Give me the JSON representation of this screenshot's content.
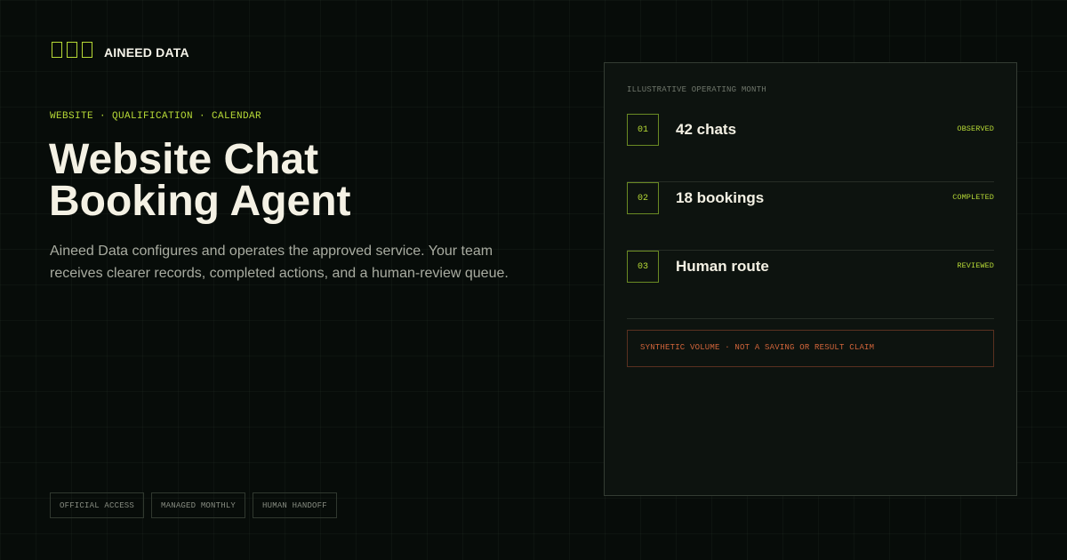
{
  "brand": {
    "name": "AINEED DATA",
    "logo_icon": "three-bracket-blocks-icon",
    "accent_color": "#b6d936"
  },
  "hero": {
    "eyebrow": "WEBSITE · QUALIFICATION · CALENDAR",
    "headline_line1": "Website Chat",
    "headline_line2": "Booking Agent",
    "description": "Aineed Data configures and operates the approved service. Your team receives clearer records, completed actions, and a human-review queue."
  },
  "tags": [
    "OFFICIAL ACCESS",
    "MANAGED MONTHLY",
    "HUMAN HANDOFF"
  ],
  "panel": {
    "label": "ILLUSTRATIVE OPERATING MONTH",
    "rows": [
      {
        "number": "01",
        "title": "42 chats",
        "status": "OBSERVED"
      },
      {
        "number": "02",
        "title": "18 bookings",
        "status": "COMPLETED"
      },
      {
        "number": "03",
        "title": "Human route",
        "status": "REVIEWED"
      }
    ],
    "disclaimer": "SYNTHETIC VOLUME · NOT A SAVING OR RESULT CLAIM",
    "disclaimer_color": "#d1643a"
  }
}
